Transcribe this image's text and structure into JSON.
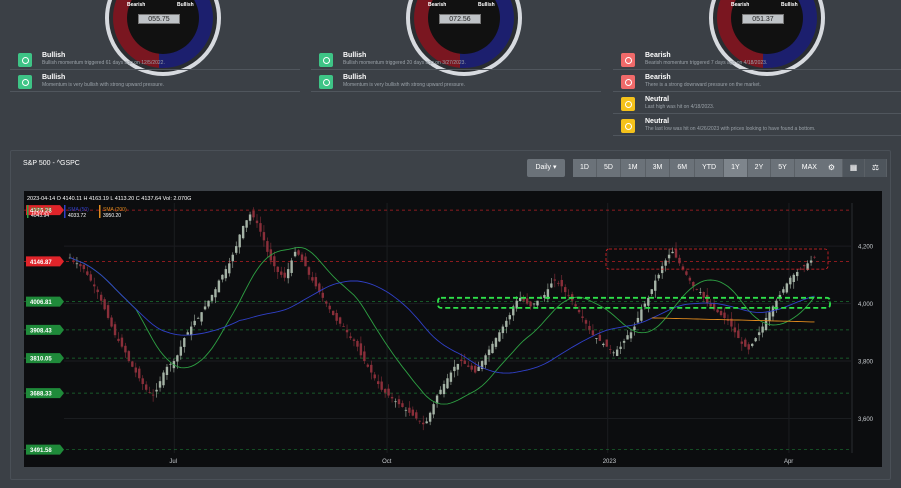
{
  "gauges": [
    {
      "bearish": "Bearish",
      "bullish": "Bullish",
      "value": "055.75"
    },
    {
      "bearish": "Bearish",
      "bullish": "Bullish",
      "value": "072.56"
    },
    {
      "bearish": "Bearish",
      "bullish": "Bullish",
      "value": "051.37"
    }
  ],
  "signals": {
    "col1": [
      {
        "title": "Bullish",
        "desc": "Bullish momentum triggered 61 days ago on 12/5/2022.",
        "color": "#3ec486"
      },
      {
        "title": "Bullish",
        "desc": "Momentum is very bullish with strong upward pressure.",
        "color": "#3ec486"
      }
    ],
    "col2": [
      {
        "title": "Bullish",
        "desc": "Bullish momentum triggered 20 days ago on 3/27/2023.",
        "color": "#3ec486"
      },
      {
        "title": "Bullish",
        "desc": "Momentum is very bullish with strong upward pressure.",
        "color": "#3ec486"
      }
    ],
    "col3": [
      {
        "title": "Bearish",
        "desc": "Bearish momentum triggered 7 days ago on 4/18/2023.",
        "color": "#f06a6a"
      },
      {
        "title": "Bearish",
        "desc": "There is a strong downward pressure on the market.",
        "color": "#f06a6a"
      },
      {
        "title": "Neutral",
        "desc": "Last high was hit on 4/18/2023.",
        "color": "#f5c21b"
      },
      {
        "title": "Neutral",
        "desc": "The last low was hit on 4/26/2023 with prices looking to have found a bottom.",
        "color": "#f5c21b"
      }
    ]
  },
  "panel": {
    "title": "S&P 500 - ^GSPC",
    "interval": "Daily ▾",
    "ranges": [
      "1D",
      "5D",
      "1M",
      "3M",
      "6M",
      "YTD",
      "1Y",
      "2Y",
      "5Y",
      "MAX"
    ],
    "active_range": "1Y"
  },
  "chart_data": {
    "type": "candlestick",
    "ohlc_header": {
      "date": "2023-04-14",
      "open_label": "O",
      "open": "4140.11",
      "high_label": "H",
      "high": "4163.19",
      "low_label": "L",
      "low": "4113.20",
      "close_label": "C",
      "close": "4137.64",
      "volume_label": "Vol",
      "volume": "2.070G"
    },
    "legend": [
      {
        "name": "SMA (20)",
        "value": "4043.94",
        "color": "#2ea043"
      },
      {
        "name": "SMA (50)",
        "value": "4033.72",
        "color": "#3040c8"
      },
      {
        "name": "SMA (200)",
        "value": "3950.20",
        "color": "#e08a1e"
      }
    ],
    "x_ticks": [
      "Jul",
      "Oct",
      "2023",
      "Apr"
    ],
    "y_ticks": [
      "4,200",
      "4,000",
      "3,800",
      "3,600"
    ],
    "ylim": [
      3480,
      4350
    ],
    "levels": [
      {
        "label": "4325.28",
        "value": 4325.28,
        "color": "#e0242a",
        "kind": "resistance"
      },
      {
        "label": "4146.87",
        "value": 4146.87,
        "color": "#e0242a",
        "kind": "resistance"
      },
      {
        "label": "4006.81",
        "value": 4006.81,
        "color": "#1f8a3a",
        "kind": "support"
      },
      {
        "label": "3908.43",
        "value": 3908.43,
        "color": "#1f8a3a",
        "kind": "support"
      },
      {
        "label": "3810.05",
        "value": 3810.05,
        "color": "#1f8a3a",
        "kind": "support"
      },
      {
        "label": "3688.33",
        "value": 3688.33,
        "color": "#1f8a3a",
        "kind": "support"
      },
      {
        "label": "3491.58",
        "value": 3491.58,
        "color": "#1f8a3a",
        "kind": "support"
      }
    ],
    "close_series": [
      4160,
      4150,
      4140,
      4130,
      4120,
      4100,
      4080,
      4060,
      4040,
      4010,
      3980,
      3950,
      3920,
      3890,
      3870,
      3850,
      3830,
      3800,
      3780,
      3760,
      3740,
      3720,
      3700,
      3690,
      3680,
      3700,
      3730,
      3760,
      3780,
      3790,
      3800,
      3820,
      3850,
      3880,
      3900,
      3920,
      3940,
      3950,
      3970,
      3990,
      4010,
      4030,
      4050,
      4080,
      4100,
      4120,
      4140,
      4170,
      4200,
      4240,
      4270,
      4290,
      4310,
      4300,
      4280,
      4250,
      4220,
      4180,
      4150,
      4130,
      4110,
      4100,
      4090,
      4120,
      4150,
      4180,
      4170,
      4150,
      4130,
      4100,
      4080,
      4060,
      4040,
      4020,
      4000,
      3980,
      3960,
      3940,
      3930,
      3920,
      3900,
      3880,
      3870,
      3850,
      3820,
      3800,
      3780,
      3760,
      3740,
      3720,
      3700,
      3690,
      3680,
      3670,
      3660,
      3650,
      3640,
      3630,
      3620,
      3610,
      3600,
      3590,
      3580,
      3590,
      3620,
      3650,
      3680,
      3700,
      3720,
      3740,
      3760,
      3780,
      3790,
      3800,
      3790,
      3780,
      3770,
      3760,
      3780,
      3800,
      3820,
      3840,
      3860,
      3880,
      3900,
      3920,
      3940,
      3960,
      3990,
      4010,
      4020,
      4010,
      4000,
      3990,
      4000,
      4010,
      4020,
      4030,
      4050,
      4070,
      4080,
      4070,
      4060,
      4040,
      4030,
      4010,
      3990,
      3970,
      3950,
      3930,
      3910,
      3890,
      3880,
      3870,
      3860,
      3850,
      3840,
      3830,
      3840,
      3850,
      3870,
      3890,
      3900,
      3920,
      3950,
      3980,
      4000,
      4020,
      4050,
      4080,
      4100,
      4130,
      4150,
      4170,
      4180,
      4160,
      4140,
      4120,
      4100,
      4080,
      4060,
      4050,
      4040,
      4020,
      4000,
      3990,
      3980,
      3970,
      3960,
      3950,
      3940,
      3920,
      3900,
      3880,
      3860,
      3850,
      3840,
      3860,
      3880,
      3900,
      3920,
      3950,
      3970,
      3990,
      4010,
      4030,
      4050,
      4070,
      4090,
      4100,
      4110,
      4120,
      4130,
      4140,
      4150,
      4160
    ]
  }
}
